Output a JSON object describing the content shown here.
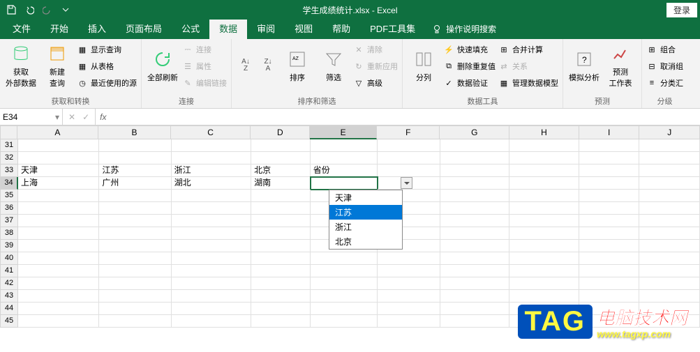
{
  "titlebar": {
    "title": "学生成绩统计.xlsx - Excel",
    "login": "登录"
  },
  "tabs": {
    "file": "文件",
    "home": "开始",
    "insert": "插入",
    "layout": "页面布局",
    "formulas": "公式",
    "data": "数据",
    "review": "审阅",
    "view": "视图",
    "help": "帮助",
    "pdf": "PDF工具集",
    "tellme": "操作说明搜索"
  },
  "ribbon": {
    "g1": {
      "label": "获取和转换",
      "ext": "获取\n外部数据",
      "newq": "新建\n查询",
      "showq": "显示查询",
      "fromtbl": "从表格",
      "recent": "最近使用的源"
    },
    "g2": {
      "label": "连接",
      "refresh": "全部刷新",
      "conn": "连接",
      "prop": "属性",
      "editlink": "编辑链接"
    },
    "g3": {
      "label": "排序和筛选",
      "sort": "排序",
      "filter": "筛选",
      "clear": "清除",
      "reapply": "重新应用",
      "adv": "高级"
    },
    "g4": {
      "label": "数据工具",
      "ttc": "分列",
      "flash": "快速填充",
      "dup": "删除重复值",
      "valid": "数据验证",
      "cons": "合并计算",
      "rel": "关系",
      "model": "管理数据模型"
    },
    "g5": {
      "label": "预测",
      "whatif": "模拟分析",
      "forecast": "预测\n工作表"
    },
    "g6": {
      "label": "分级",
      "group": "组合",
      "ungroup": "取消组",
      "subtotal": "分类汇"
    }
  },
  "formula_bar": {
    "cellref": "E34",
    "fx": "fx",
    "value": ""
  },
  "grid": {
    "cols": [
      "A",
      "B",
      "C",
      "D",
      "E",
      "F",
      "G",
      "H",
      "I",
      "J"
    ],
    "widths": [
      124,
      110,
      122,
      90,
      102,
      96,
      106,
      106,
      92,
      92
    ],
    "first_row": 31,
    "row_count": 15,
    "active": {
      "col": "E",
      "row": 34
    },
    "cells": {
      "A33": "天津",
      "B33": "江苏",
      "C33": "浙江",
      "D33": "北京",
      "E33": "省份",
      "A34": "上海",
      "B34": "广州",
      "C34": "湖北",
      "D34": "湖南"
    },
    "dropdown": {
      "cell": "E34",
      "options": [
        "天津",
        "江苏",
        "浙江",
        "北京"
      ],
      "highlighted": 1
    }
  },
  "watermark": {
    "tag": "TAG",
    "title": "电脑技术网",
    "url": "www.tagxp.com"
  }
}
